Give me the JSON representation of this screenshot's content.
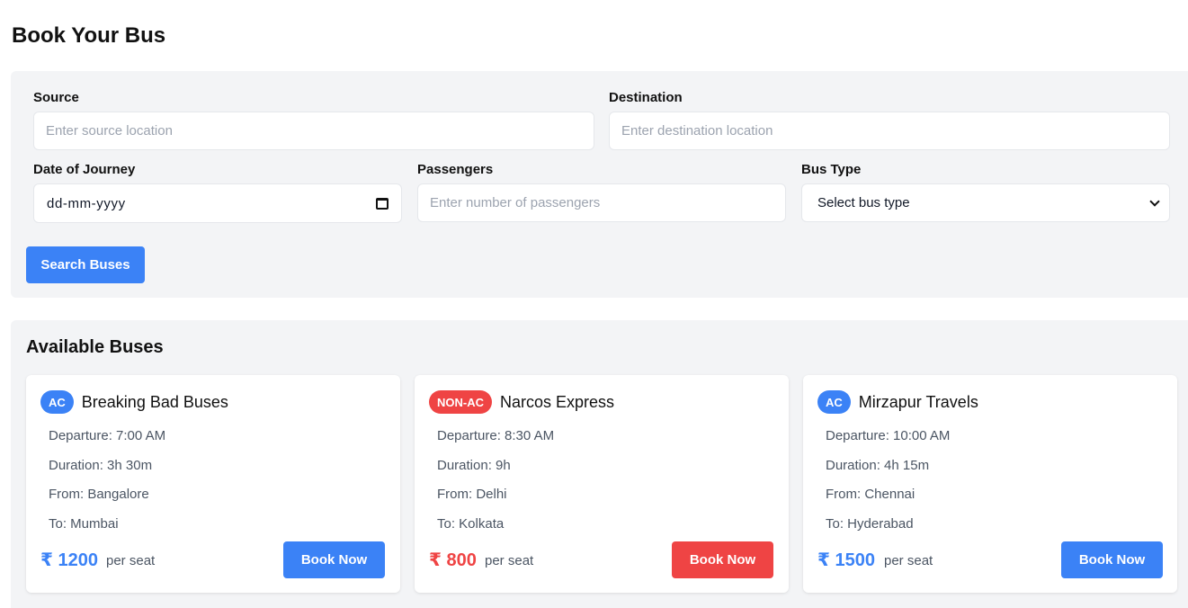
{
  "page": {
    "title": "Book Your Bus"
  },
  "search": {
    "source_label": "Source",
    "source_placeholder": "Enter source location",
    "destination_label": "Destination",
    "destination_placeholder": "Enter destination location",
    "date_label": "Date of Journey",
    "date_value": "dd-mm-yyyy",
    "passengers_label": "Passengers",
    "passengers_placeholder": "Enter number of passengers",
    "bus_type_label": "Bus Type",
    "bus_type_value": "Select bus type",
    "button_label": "Search Buses"
  },
  "results": {
    "title": "Available Buses",
    "buses": [
      {
        "type": "AC",
        "name": "Breaking Bad Buses",
        "departure": "Departure: 7:00 AM",
        "duration": "Duration: 3h 30m",
        "from": "From: Bangalore",
        "to": "To: Mumbai",
        "price": "₹ 1200",
        "per": "per seat",
        "button": "Book Now",
        "accent": "#3b82f6"
      },
      {
        "type": "NON-AC",
        "name": "Narcos Express",
        "departure": "Departure: 8:30 AM",
        "duration": "Duration: 9h",
        "from": "From: Delhi",
        "to": "To: Kolkata",
        "price": "₹ 800",
        "per": "per seat",
        "button": "Book Now",
        "accent": "#ef4444"
      },
      {
        "type": "AC",
        "name": "Mirzapur Travels",
        "departure": "Departure: 10:00 AM",
        "duration": "Duration: 4h 15m",
        "from": "From: Chennai",
        "to": "To: Hyderabad",
        "price": "₹ 1500",
        "per": "per seat",
        "button": "Book Now",
        "accent": "#3b82f6"
      }
    ]
  },
  "colors": {
    "primary": "#3b82f6",
    "danger": "#ef4444",
    "panel": "#f3f4f6"
  },
  "icons": {
    "calendar": "calendar-icon",
    "dropdown": "chevron-down-icon"
  }
}
